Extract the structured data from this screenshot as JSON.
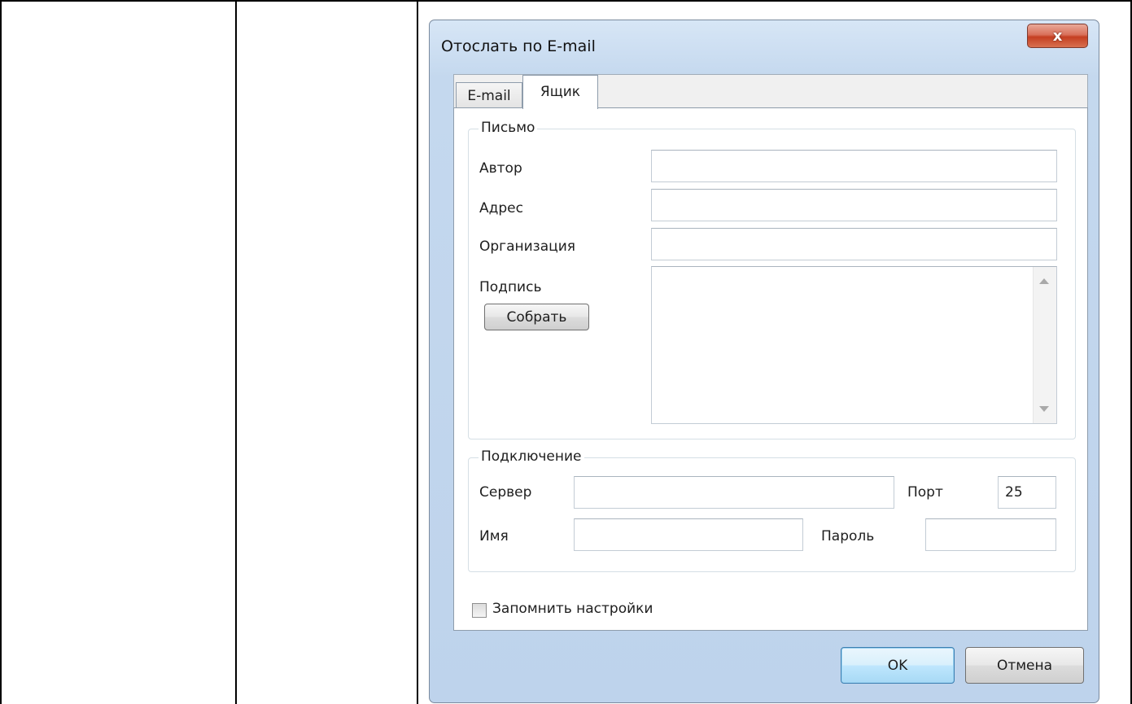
{
  "dialog": {
    "title": "Отослать по E-mail",
    "close_glyph": "x",
    "tabs": [
      {
        "label": "E-mail",
        "active": false
      },
      {
        "label": "Ящик",
        "active": true
      }
    ]
  },
  "letter_group": {
    "title": "Письмо",
    "author_label": "Автор",
    "author_value": "",
    "address_label": "Адрес",
    "address_value": "",
    "organization_label": "Организация",
    "organization_value": "",
    "signature_label": "Подпись",
    "signature_value": "",
    "collect_button": "Собрать"
  },
  "connection_group": {
    "title": "Подключение",
    "server_label": "Сервер",
    "server_value": "",
    "port_label": "Порт",
    "port_value": "25",
    "name_label": "Имя",
    "name_value": "",
    "password_label": "Пароль",
    "password_value": ""
  },
  "remember": {
    "label": "Запомнить настройки",
    "checked": false
  },
  "footer": {
    "ok_label": "OK",
    "cancel_label": "Отмена"
  },
  "colors": {
    "frame": "#c4d8ee",
    "close_button": "#c43f22",
    "ok_accent": "#3c7fb1"
  }
}
